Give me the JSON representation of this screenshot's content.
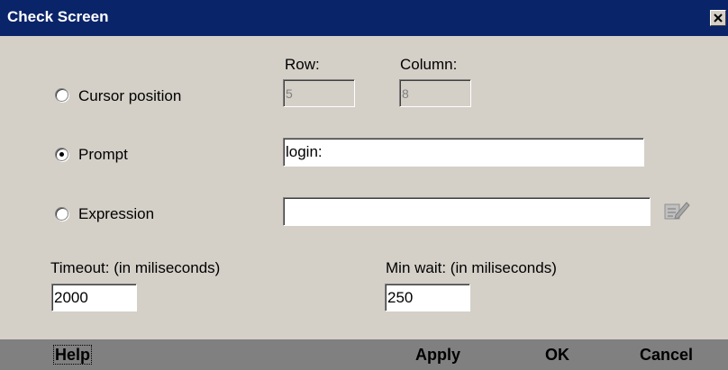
{
  "window": {
    "title": "Check Screen"
  },
  "cursor_position": {
    "label": "Cursor position",
    "selected": false,
    "row_label": "Row:",
    "row_value": "5",
    "column_label": "Column:",
    "column_value": "8"
  },
  "prompt": {
    "label": "Prompt",
    "selected": true,
    "value": "login:"
  },
  "expression": {
    "label": "Expression",
    "selected": false,
    "value": ""
  },
  "timeout": {
    "label": "Timeout: (in miliseconds)",
    "value": "2000"
  },
  "min_wait": {
    "label": "Min wait: (in miliseconds)",
    "value": "250"
  },
  "footer": {
    "help_label": "Help",
    "apply_label": "Apply",
    "ok_label": "OK",
    "cancel_label": "Cancel"
  },
  "icons": {
    "close": "close-icon",
    "edit": "edit-expression-icon"
  },
  "colors": {
    "titlebar": "#0a246a",
    "dialog_bg": "#d4d0c8",
    "footer_bg": "#808080"
  }
}
